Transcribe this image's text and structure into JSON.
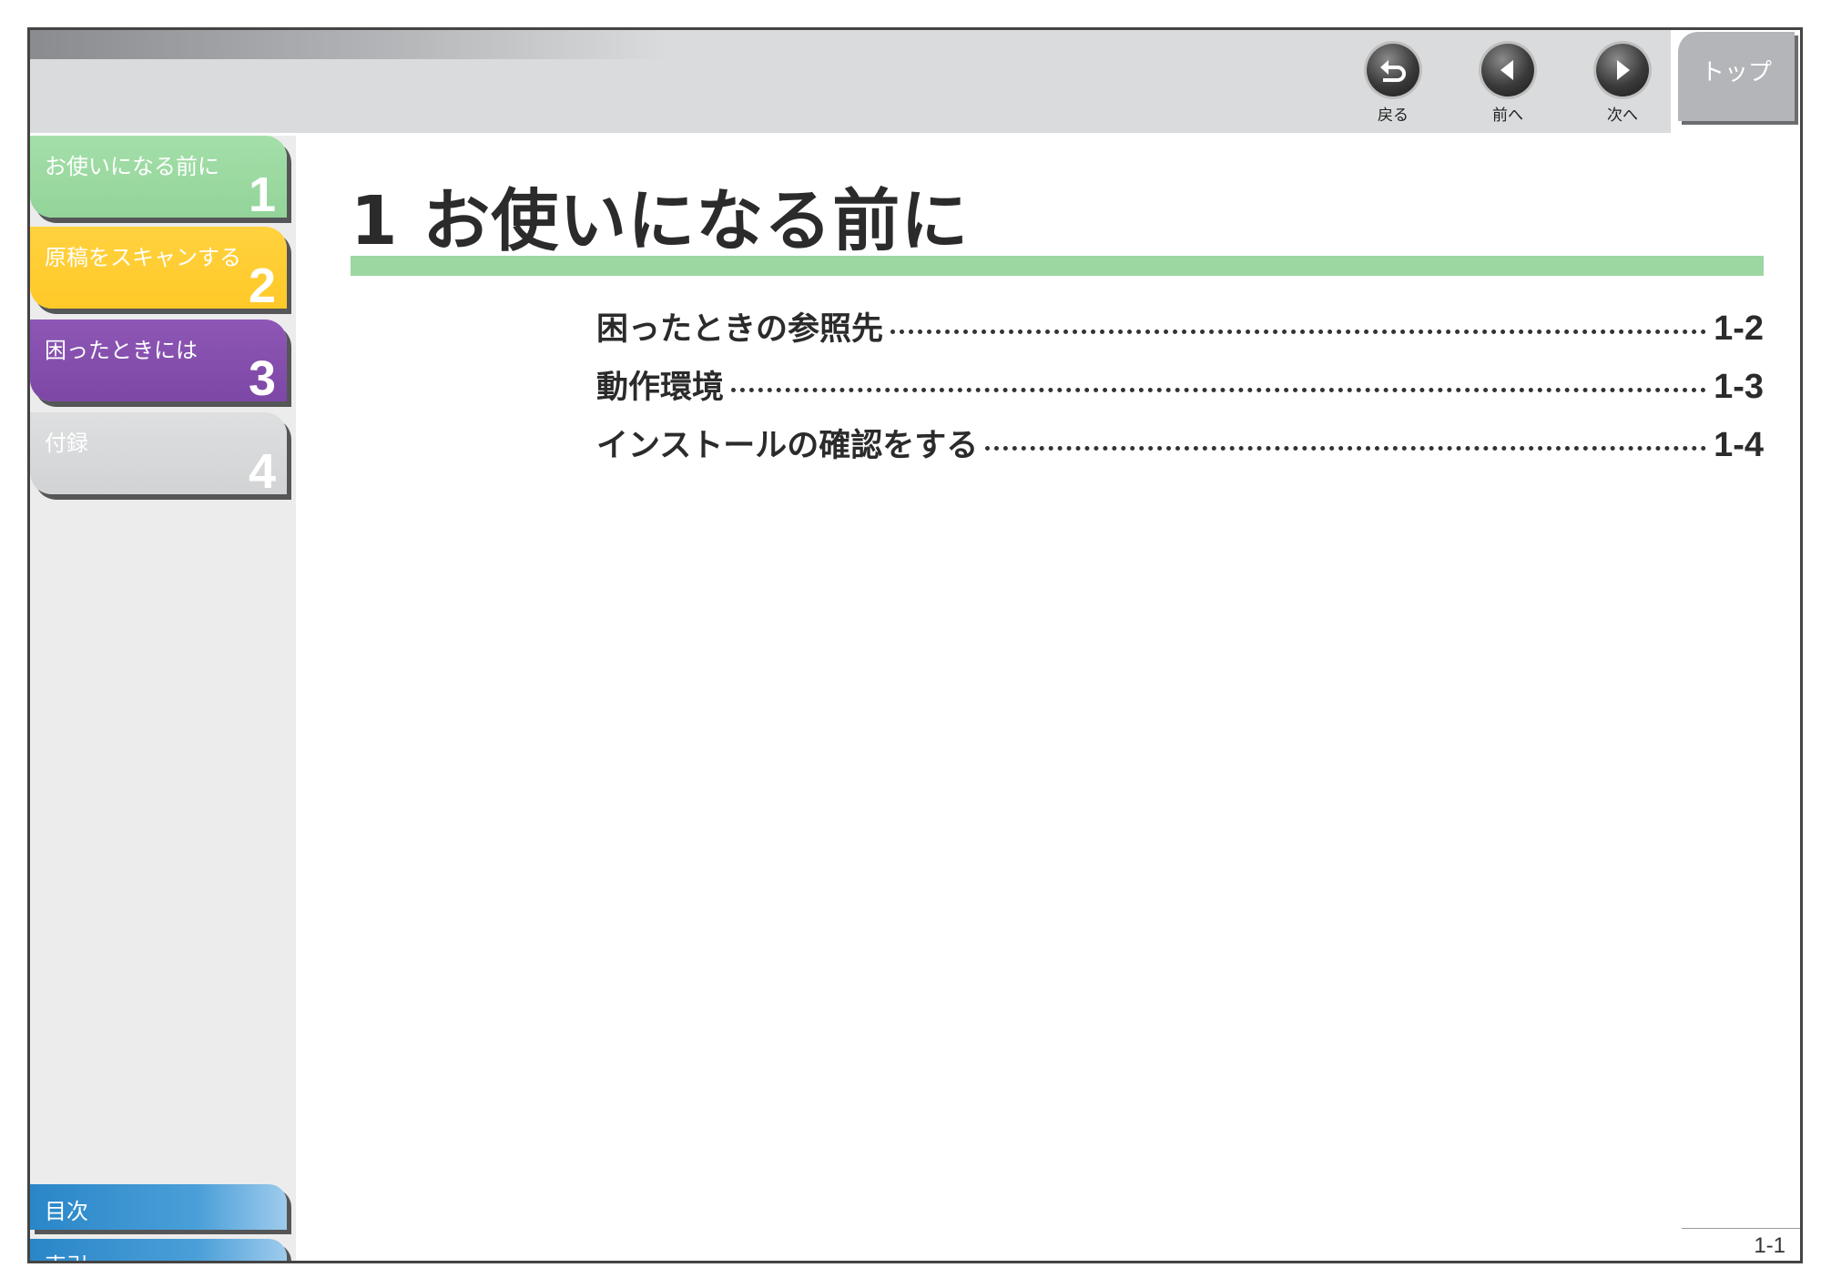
{
  "header": {
    "back_label": "戻る",
    "prev_label": "前へ",
    "next_label": "次へ",
    "top_label": "トップ"
  },
  "sidebar": {
    "tabs": [
      {
        "label": "お使いになる前に",
        "num": "1",
        "color": "#9cd7a2"
      },
      {
        "label": "原稿をスキャンする",
        "num": "2",
        "color": "#ffcd33"
      },
      {
        "label": "困ったときには",
        "num": "3",
        "color": "#854eae"
      },
      {
        "label": "付録",
        "num": "4",
        "color": "#d8d9da"
      }
    ],
    "contents_label": "目次",
    "index_label": "索引"
  },
  "main": {
    "title": "1 お使いになる前に",
    "title_bar_color": "#9cd7a2",
    "toc": [
      {
        "text": "困ったときの参照先",
        "page": "1-2"
      },
      {
        "text": "動作環境",
        "page": "1-3"
      },
      {
        "text": "インストールの確認をする",
        "page": "1-4"
      }
    ]
  },
  "footer": {
    "page_number": "1-1"
  }
}
